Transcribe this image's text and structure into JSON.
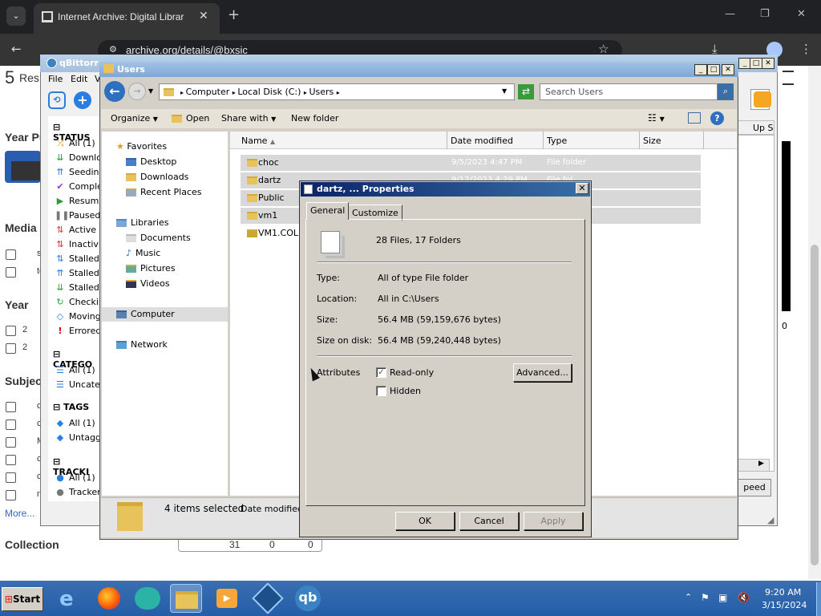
{
  "chrome": {
    "tab_title": "Internet Archive: Digital Librar",
    "url": "archive.org/details/@bxsic",
    "win_min": "—",
    "win_max": "❐",
    "win_close": "✕",
    "tab_close": "✕",
    "new_tab": "+",
    "tab_list": "⌄"
  },
  "web": {
    "results_count": "5",
    "results_label": "Res",
    "year_pub": "Year Pu",
    "media": "Media",
    "media_items": [
      "s",
      "te"
    ],
    "year": "Year",
    "year_items": [
      "2",
      "2"
    ],
    "subject": "Subjec",
    "subject_items": [
      "c",
      "c",
      "M",
      "c",
      "c",
      "n"
    ],
    "more": "More...",
    "collection": "Collection",
    "table_vals": [
      "31",
      "0",
      "0"
    ],
    "up_speed": "Up S",
    "speed_btn": "peed",
    "zero": "0"
  },
  "qbt": {
    "title": "qBittorr",
    "menu": [
      "File",
      "Edit",
      "V"
    ],
    "status_header": "STATUS",
    "status_items": [
      "All (1)",
      "Downlo",
      "Seedin",
      "Comple",
      "Resume",
      "Paused",
      "Active",
      "Inactiv",
      "Stalled",
      "Stalled",
      "Stalled",
      "Checkir",
      "Moving",
      "Errored"
    ],
    "categories_header": "CATEGO",
    "categories_items": [
      "All (1)",
      "Uncate"
    ],
    "tags_header": "TAGS",
    "tags_items": [
      "All (1)",
      "Untagg"
    ],
    "trackers_header": "TRACKI",
    "trackers_items": [
      "All (1)",
      "Tracker"
    ]
  },
  "explorer": {
    "title": "Users",
    "breadcrumb": [
      "Computer",
      "Local Disk (C:)",
      "Users"
    ],
    "search_placeholder": "Search Users",
    "commands": {
      "organize": "Organize",
      "open": "Open",
      "share": "Share with",
      "new_folder": "New folder"
    },
    "nav": {
      "favorites": "Favorites",
      "fav_items": [
        "Desktop",
        "Downloads",
        "Recent Places"
      ],
      "libraries": "Libraries",
      "lib_items": [
        "Documents",
        "Music",
        "Pictures",
        "Videos"
      ],
      "computer": "Computer",
      "network": "Network"
    },
    "columns": {
      "name": "Name",
      "date": "Date modified",
      "type": "Type",
      "size": "Size"
    },
    "rows": [
      {
        "name": "choc",
        "date": "9/5/2023 4:47 PM",
        "type": "File folder"
      },
      {
        "name": "dartz",
        "date": "9/12/2023 4:29 PM",
        "type": "File fol"
      },
      {
        "name": "Public",
        "date": "",
        "type": ""
      },
      {
        "name": "vm1",
        "date": "",
        "type": ""
      },
      {
        "name": "VM1.COLL",
        "date": "",
        "type": ""
      }
    ],
    "details_selected": "4 items selected",
    "details_date": "Date modified:"
  },
  "dialog": {
    "title": "dartz, ... Properties",
    "tabs": {
      "general": "General",
      "customize": "Customize"
    },
    "summary": "28 Files, 17 Folders",
    "type_label": "Type:",
    "type_value": "All of type File folder",
    "location_label": "Location:",
    "location_value": "All in C:\\Users",
    "size_label": "Size:",
    "size_value": "56.4 MB (59,159,676 bytes)",
    "disk_label": "Size on disk:",
    "disk_value": "56.4 MB (59,240,448 bytes)",
    "attributes_label": "Attributes",
    "readonly_label": "Read-only",
    "hidden_label": "Hidden",
    "advanced_btn": "Advanced...",
    "ok_btn": "OK",
    "cancel_btn": "Cancel",
    "apply_btn": "Apply",
    "close_glyph": "✕"
  },
  "taskbar": {
    "start": "Start",
    "time": "9:20 AM",
    "date": "3/15/2024",
    "qb_label": "qb"
  }
}
